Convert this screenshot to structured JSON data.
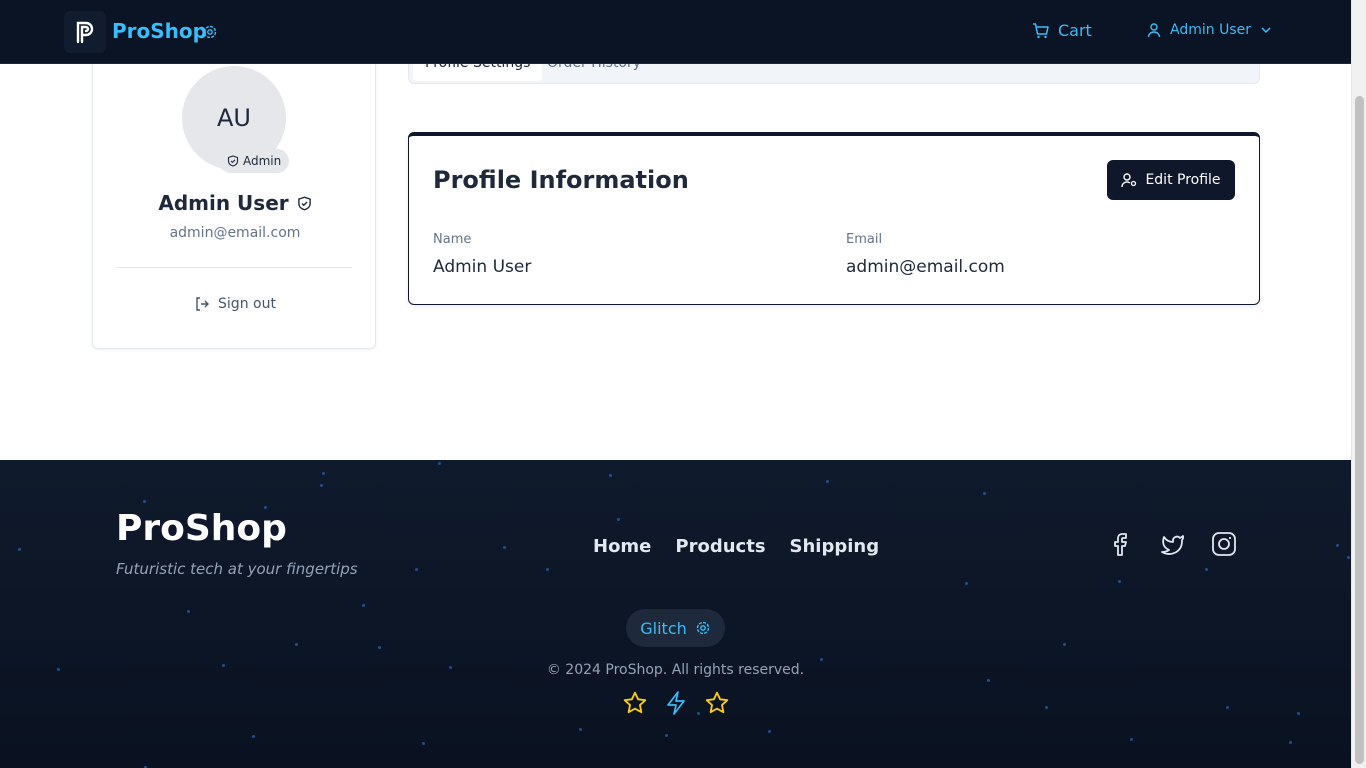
{
  "header": {
    "brand": "ProShop",
    "cart_label": "Cart",
    "user_label": "Admin User"
  },
  "sidebar": {
    "avatar_initials": "AU",
    "role_badge": "Admin",
    "name": "Admin User",
    "email": "admin@email.com",
    "signout_label": "Sign out"
  },
  "tabs": [
    {
      "label": "Profile Settings",
      "active": true
    },
    {
      "label": "Order History",
      "active": false
    }
  ],
  "profile": {
    "title": "Profile Information",
    "edit_label": "Edit Profile",
    "fields": [
      {
        "label": "Name",
        "value": "Admin User"
      },
      {
        "label": "Email",
        "value": "admin@email.com"
      }
    ]
  },
  "footer": {
    "brand": "ProShop",
    "tagline": "Futuristic tech at your fingertips",
    "nav": [
      "Home",
      "Products",
      "Shipping"
    ],
    "socials": [
      "facebook-icon",
      "twitter-icon",
      "instagram-icon"
    ],
    "glitch_label": "Glitch",
    "copyright": "© 2024 ProShop. All rights reserved."
  },
  "colors": {
    "accent": "#38bdf8",
    "header_bg": "#0b1424",
    "footer_bg": "#0f1a2c",
    "primary_button": "#0f172a",
    "star": "#facc15"
  }
}
